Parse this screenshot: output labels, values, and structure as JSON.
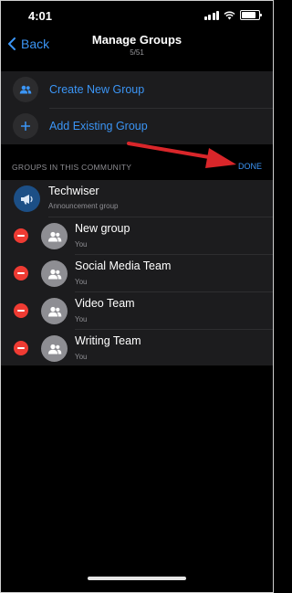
{
  "status_bar": {
    "time": "4:01"
  },
  "nav": {
    "back_label": "Back",
    "title": "Manage Groups",
    "subtitle": "5/51"
  },
  "actions": [
    {
      "label": "Create New Group",
      "icon": "people-icon"
    },
    {
      "label": "Add Existing Group",
      "icon": "plus-icon"
    }
  ],
  "section": {
    "title": "GROUPS IN THIS COMMUNITY",
    "done_label": "DONE"
  },
  "groups": [
    {
      "name": "Techwiser",
      "subtitle": "Announcement group",
      "removable": false
    },
    {
      "name": "New group",
      "subtitle": "You",
      "removable": true
    },
    {
      "name": "Social Media Team",
      "subtitle": "You",
      "removable": true
    },
    {
      "name": "Video Team",
      "subtitle": "You",
      "removable": true
    },
    {
      "name": "Writing Team",
      "subtitle": "You",
      "removable": true
    }
  ],
  "colors": {
    "accent": "#3b95f5",
    "remove": "#ef3b33",
    "panel": "#1c1c1e",
    "annotation_arrow": "#d9262a"
  }
}
